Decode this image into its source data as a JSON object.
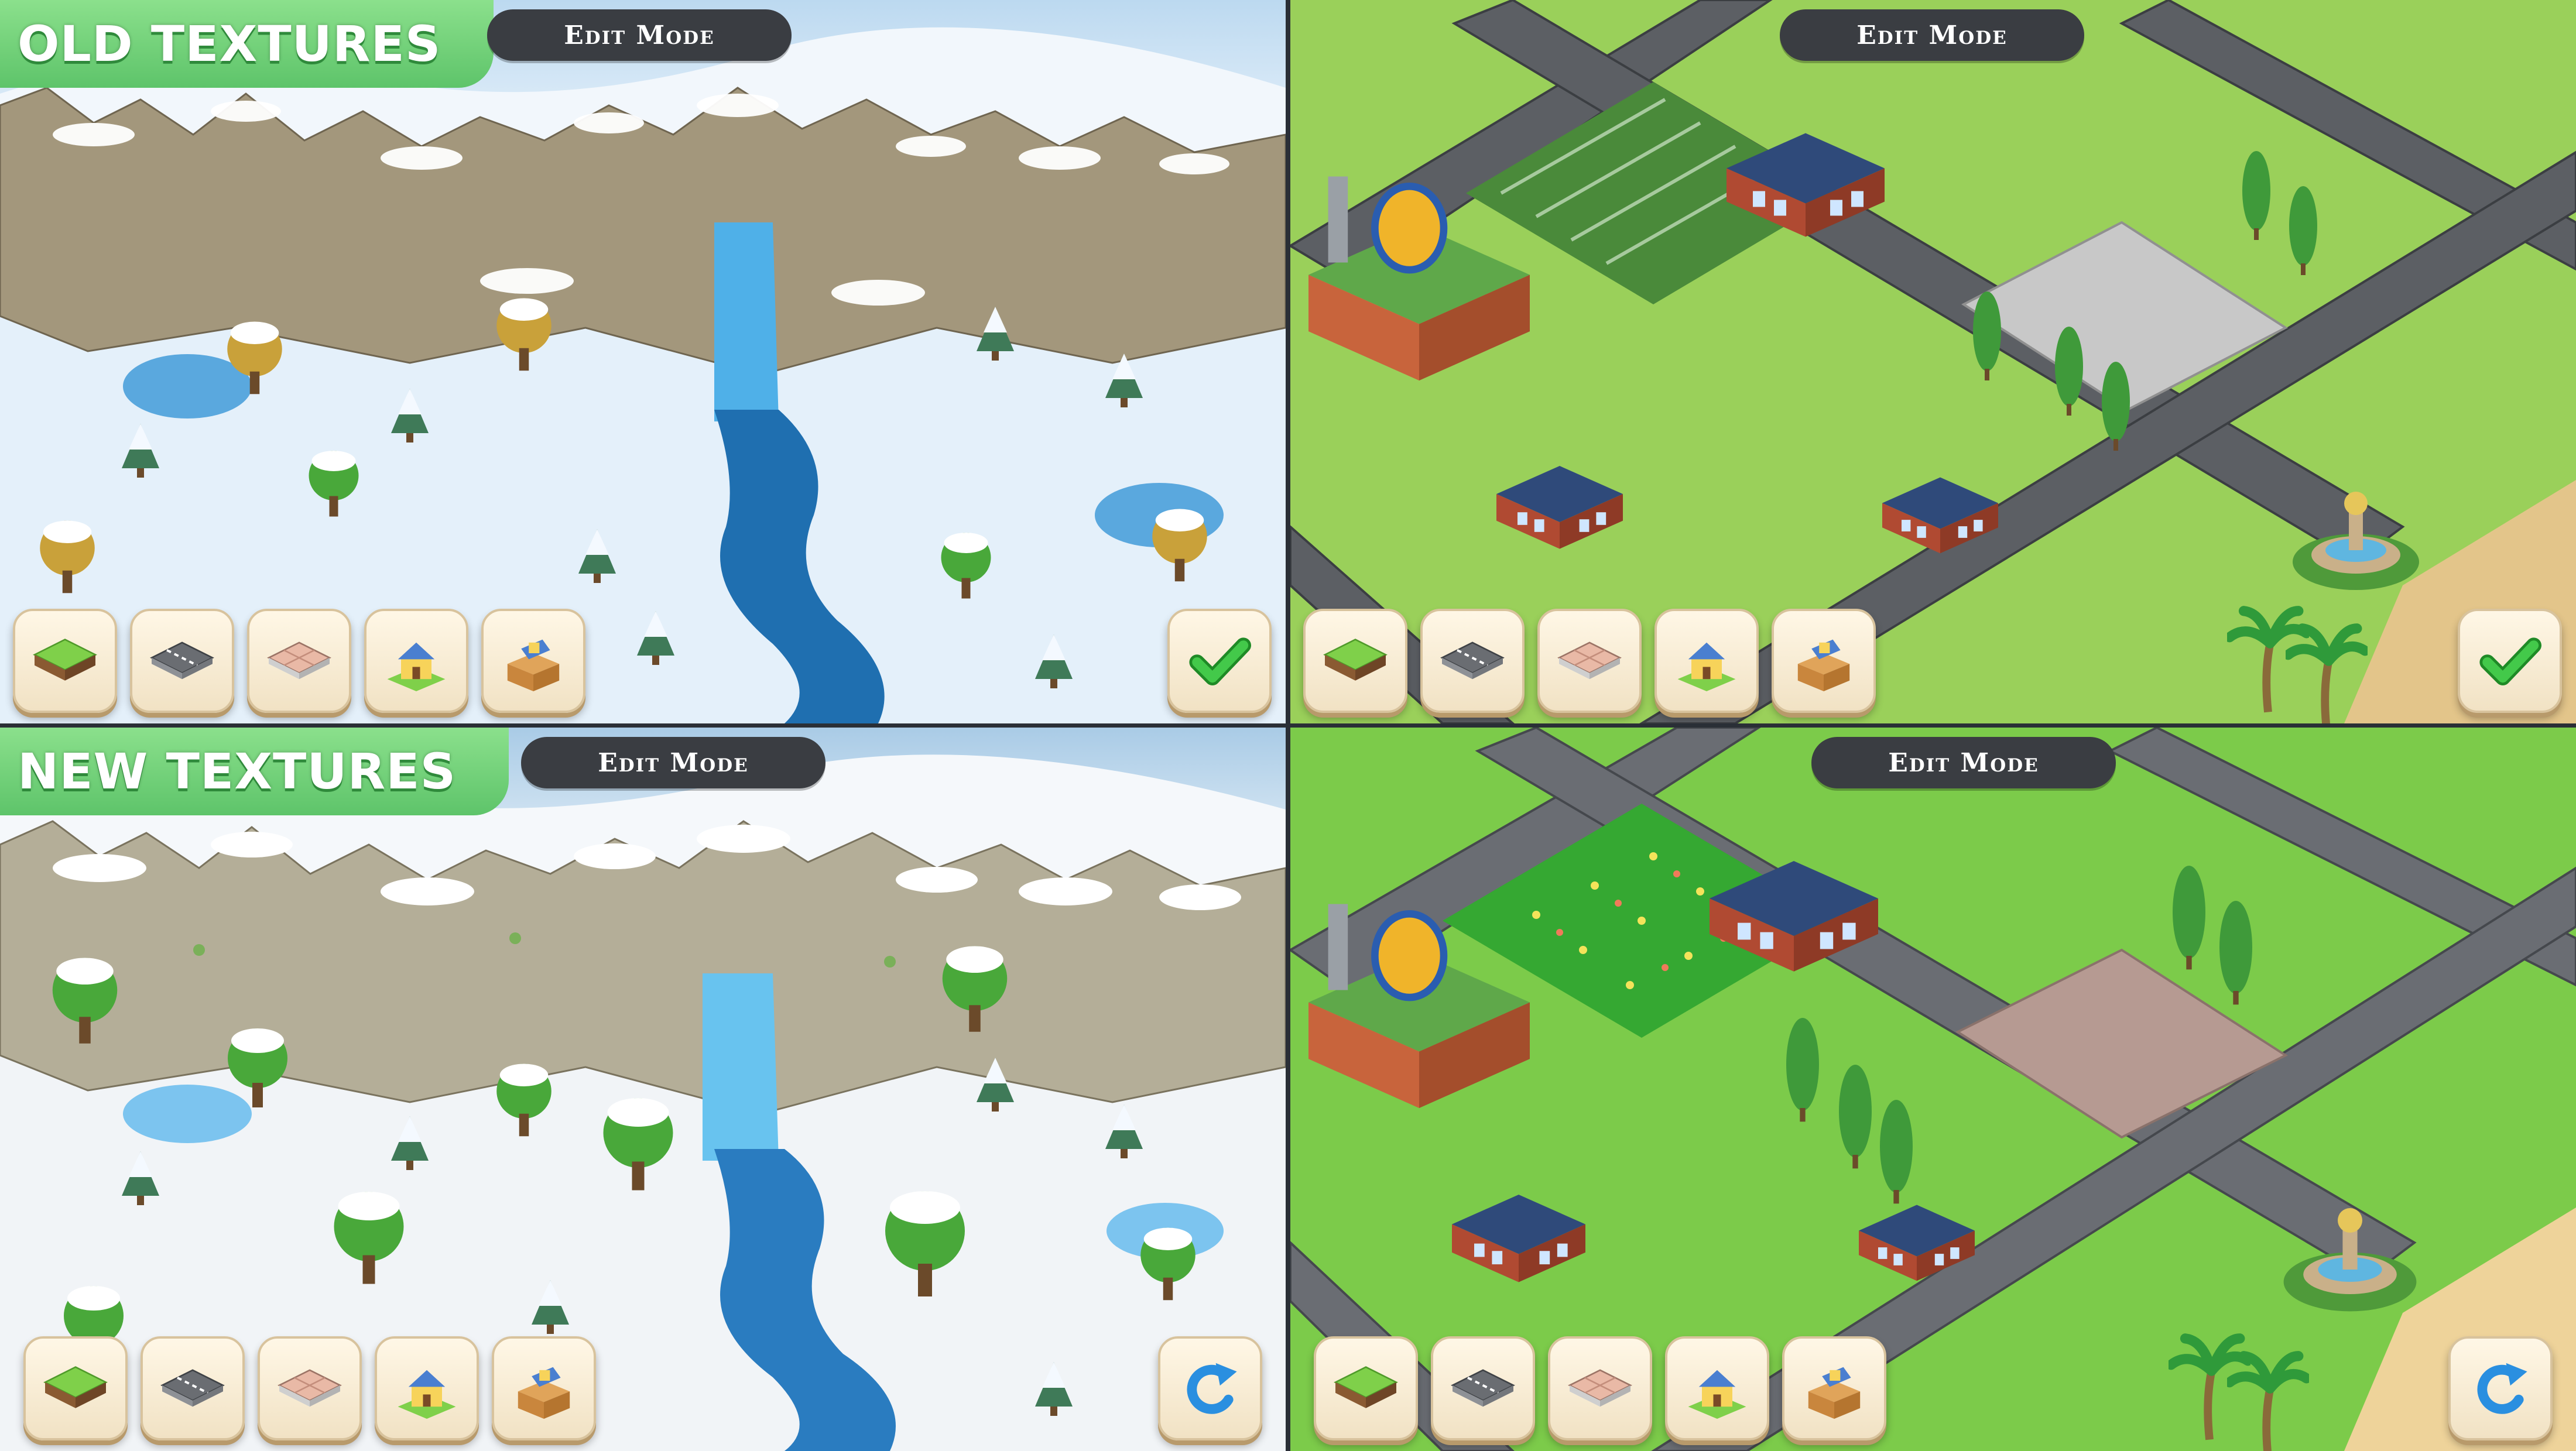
{
  "panels": {
    "top_left": {
      "banner": "OLD TEXTURES",
      "edit_mode_label": "Edit Mode",
      "confirm_icon": "checkmark-icon"
    },
    "top_right": {
      "edit_mode_label": "Edit Mode",
      "confirm_icon": "checkmark-icon"
    },
    "bottom_left": {
      "banner": "NEW TEXTURES",
      "edit_mode_label": "Edit Mode",
      "confirm_icon": "rotate-icon"
    },
    "bottom_right": {
      "edit_mode_label": "Edit Mode",
      "confirm_icon": "rotate-icon"
    }
  },
  "toolbar_icons": [
    "grass-tile-icon",
    "road-tile-icon",
    "pavement-tile-icon",
    "house-icon",
    "storage-box-icon"
  ],
  "colors": {
    "banner_green": "#6fd07a",
    "pill_bg": "#3a3d42",
    "button_bg": "#f5e8cf",
    "check_green": "#33b53a",
    "rotate_blue": "#2a8fe0"
  }
}
